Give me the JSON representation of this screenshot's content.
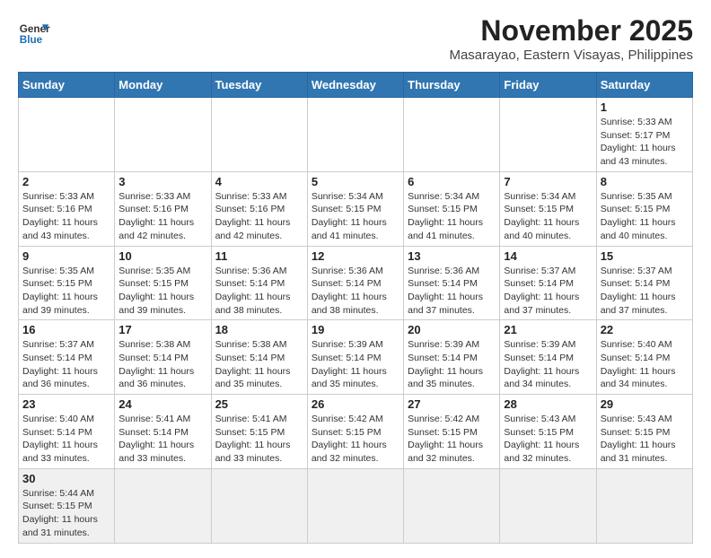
{
  "header": {
    "logo_line1": "General",
    "logo_line2": "Blue",
    "title": "November 2025",
    "subtitle": "Masarayao, Eastern Visayas, Philippines"
  },
  "weekdays": [
    "Sunday",
    "Monday",
    "Tuesday",
    "Wednesday",
    "Thursday",
    "Friday",
    "Saturday"
  ],
  "weeks": [
    [
      {
        "day": "",
        "info": ""
      },
      {
        "day": "",
        "info": ""
      },
      {
        "day": "",
        "info": ""
      },
      {
        "day": "",
        "info": ""
      },
      {
        "day": "",
        "info": ""
      },
      {
        "day": "",
        "info": ""
      },
      {
        "day": "1",
        "info": "Sunrise: 5:33 AM\nSunset: 5:17 PM\nDaylight: 11 hours\nand 43 minutes."
      }
    ],
    [
      {
        "day": "2",
        "info": "Sunrise: 5:33 AM\nSunset: 5:16 PM\nDaylight: 11 hours\nand 43 minutes."
      },
      {
        "day": "3",
        "info": "Sunrise: 5:33 AM\nSunset: 5:16 PM\nDaylight: 11 hours\nand 42 minutes."
      },
      {
        "day": "4",
        "info": "Sunrise: 5:33 AM\nSunset: 5:16 PM\nDaylight: 11 hours\nand 42 minutes."
      },
      {
        "day": "5",
        "info": "Sunrise: 5:34 AM\nSunset: 5:15 PM\nDaylight: 11 hours\nand 41 minutes."
      },
      {
        "day": "6",
        "info": "Sunrise: 5:34 AM\nSunset: 5:15 PM\nDaylight: 11 hours\nand 41 minutes."
      },
      {
        "day": "7",
        "info": "Sunrise: 5:34 AM\nSunset: 5:15 PM\nDaylight: 11 hours\nand 40 minutes."
      },
      {
        "day": "8",
        "info": "Sunrise: 5:35 AM\nSunset: 5:15 PM\nDaylight: 11 hours\nand 40 minutes."
      }
    ],
    [
      {
        "day": "9",
        "info": "Sunrise: 5:35 AM\nSunset: 5:15 PM\nDaylight: 11 hours\nand 39 minutes."
      },
      {
        "day": "10",
        "info": "Sunrise: 5:35 AM\nSunset: 5:15 PM\nDaylight: 11 hours\nand 39 minutes."
      },
      {
        "day": "11",
        "info": "Sunrise: 5:36 AM\nSunset: 5:14 PM\nDaylight: 11 hours\nand 38 minutes."
      },
      {
        "day": "12",
        "info": "Sunrise: 5:36 AM\nSunset: 5:14 PM\nDaylight: 11 hours\nand 38 minutes."
      },
      {
        "day": "13",
        "info": "Sunrise: 5:36 AM\nSunset: 5:14 PM\nDaylight: 11 hours\nand 37 minutes."
      },
      {
        "day": "14",
        "info": "Sunrise: 5:37 AM\nSunset: 5:14 PM\nDaylight: 11 hours\nand 37 minutes."
      },
      {
        "day": "15",
        "info": "Sunrise: 5:37 AM\nSunset: 5:14 PM\nDaylight: 11 hours\nand 37 minutes."
      }
    ],
    [
      {
        "day": "16",
        "info": "Sunrise: 5:37 AM\nSunset: 5:14 PM\nDaylight: 11 hours\nand 36 minutes."
      },
      {
        "day": "17",
        "info": "Sunrise: 5:38 AM\nSunset: 5:14 PM\nDaylight: 11 hours\nand 36 minutes."
      },
      {
        "day": "18",
        "info": "Sunrise: 5:38 AM\nSunset: 5:14 PM\nDaylight: 11 hours\nand 35 minutes."
      },
      {
        "day": "19",
        "info": "Sunrise: 5:39 AM\nSunset: 5:14 PM\nDaylight: 11 hours\nand 35 minutes."
      },
      {
        "day": "20",
        "info": "Sunrise: 5:39 AM\nSunset: 5:14 PM\nDaylight: 11 hours\nand 35 minutes."
      },
      {
        "day": "21",
        "info": "Sunrise: 5:39 AM\nSunset: 5:14 PM\nDaylight: 11 hours\nand 34 minutes."
      },
      {
        "day": "22",
        "info": "Sunrise: 5:40 AM\nSunset: 5:14 PM\nDaylight: 11 hours\nand 34 minutes."
      }
    ],
    [
      {
        "day": "23",
        "info": "Sunrise: 5:40 AM\nSunset: 5:14 PM\nDaylight: 11 hours\nand 33 minutes."
      },
      {
        "day": "24",
        "info": "Sunrise: 5:41 AM\nSunset: 5:14 PM\nDaylight: 11 hours\nand 33 minutes."
      },
      {
        "day": "25",
        "info": "Sunrise: 5:41 AM\nSunset: 5:15 PM\nDaylight: 11 hours\nand 33 minutes."
      },
      {
        "day": "26",
        "info": "Sunrise: 5:42 AM\nSunset: 5:15 PM\nDaylight: 11 hours\nand 32 minutes."
      },
      {
        "day": "27",
        "info": "Sunrise: 5:42 AM\nSunset: 5:15 PM\nDaylight: 11 hours\nand 32 minutes."
      },
      {
        "day": "28",
        "info": "Sunrise: 5:43 AM\nSunset: 5:15 PM\nDaylight: 11 hours\nand 32 minutes."
      },
      {
        "day": "29",
        "info": "Sunrise: 5:43 AM\nSunset: 5:15 PM\nDaylight: 11 hours\nand 31 minutes."
      }
    ],
    [
      {
        "day": "30",
        "info": "Sunrise: 5:44 AM\nSunset: 5:15 PM\nDaylight: 11 hours\nand 31 minutes."
      },
      {
        "day": "",
        "info": ""
      },
      {
        "day": "",
        "info": ""
      },
      {
        "day": "",
        "info": ""
      },
      {
        "day": "",
        "info": ""
      },
      {
        "day": "",
        "info": ""
      },
      {
        "day": "",
        "info": ""
      }
    ]
  ]
}
